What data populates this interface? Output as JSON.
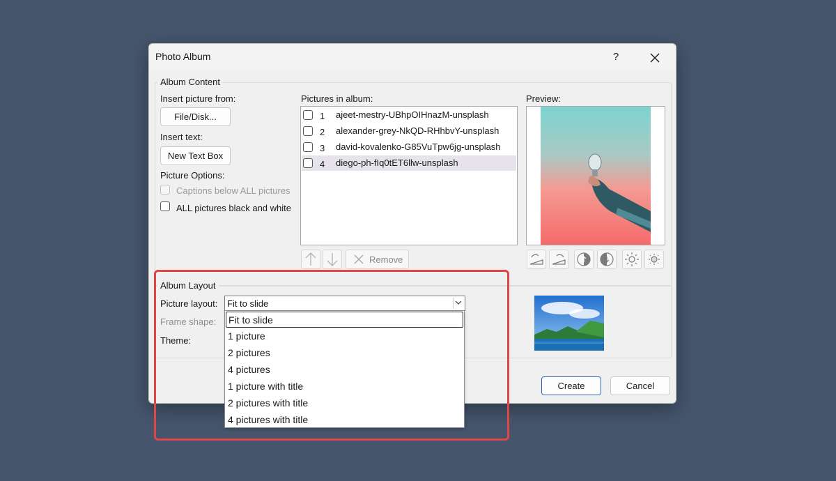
{
  "dialog": {
    "title": "Photo Album",
    "help_label": "?",
    "close_label": "✕"
  },
  "album_content": {
    "group_label": "Album Content",
    "insert_picture_label": "Insert picture from:",
    "file_disk_button": "File/Disk...",
    "insert_text_label": "Insert text:",
    "new_text_box_button": "New Text Box",
    "picture_options_label": "Picture Options:",
    "captions_option": "Captions below ALL pictures",
    "black_white_option": "ALL pictures black and white",
    "pictures_in_album_label": "Pictures in album:",
    "pictures": [
      {
        "num": "1",
        "name": "ajeet-mestry-UBhpOIHnazM-unsplash"
      },
      {
        "num": "2",
        "name": "alexander-grey-NkQD-RHhbvY-unsplash"
      },
      {
        "num": "3",
        "name": "david-kovalenko-G85VuTpw6jg-unsplash"
      },
      {
        "num": "4",
        "name": "diego-ph-fIq0tET6llw-unsplash"
      }
    ],
    "remove_button": "Remove",
    "preview_label": "Preview:"
  },
  "album_layout": {
    "group_label": "Album Layout",
    "picture_layout_label": "Picture layout:",
    "picture_layout_value": "Fit to slide",
    "frame_shape_label": "Frame shape:",
    "theme_label": "Theme:",
    "layout_options": [
      "Fit to slide",
      "1 picture",
      "2 pictures",
      "4 pictures",
      "1 picture with title",
      "2 pictures with title",
      "4 pictures with title"
    ]
  },
  "footer": {
    "create_button": "Create",
    "cancel_button": "Cancel"
  },
  "colors": {
    "background": "#45556c",
    "highlight": "#e04646",
    "primary_border": "#2b62c0"
  }
}
